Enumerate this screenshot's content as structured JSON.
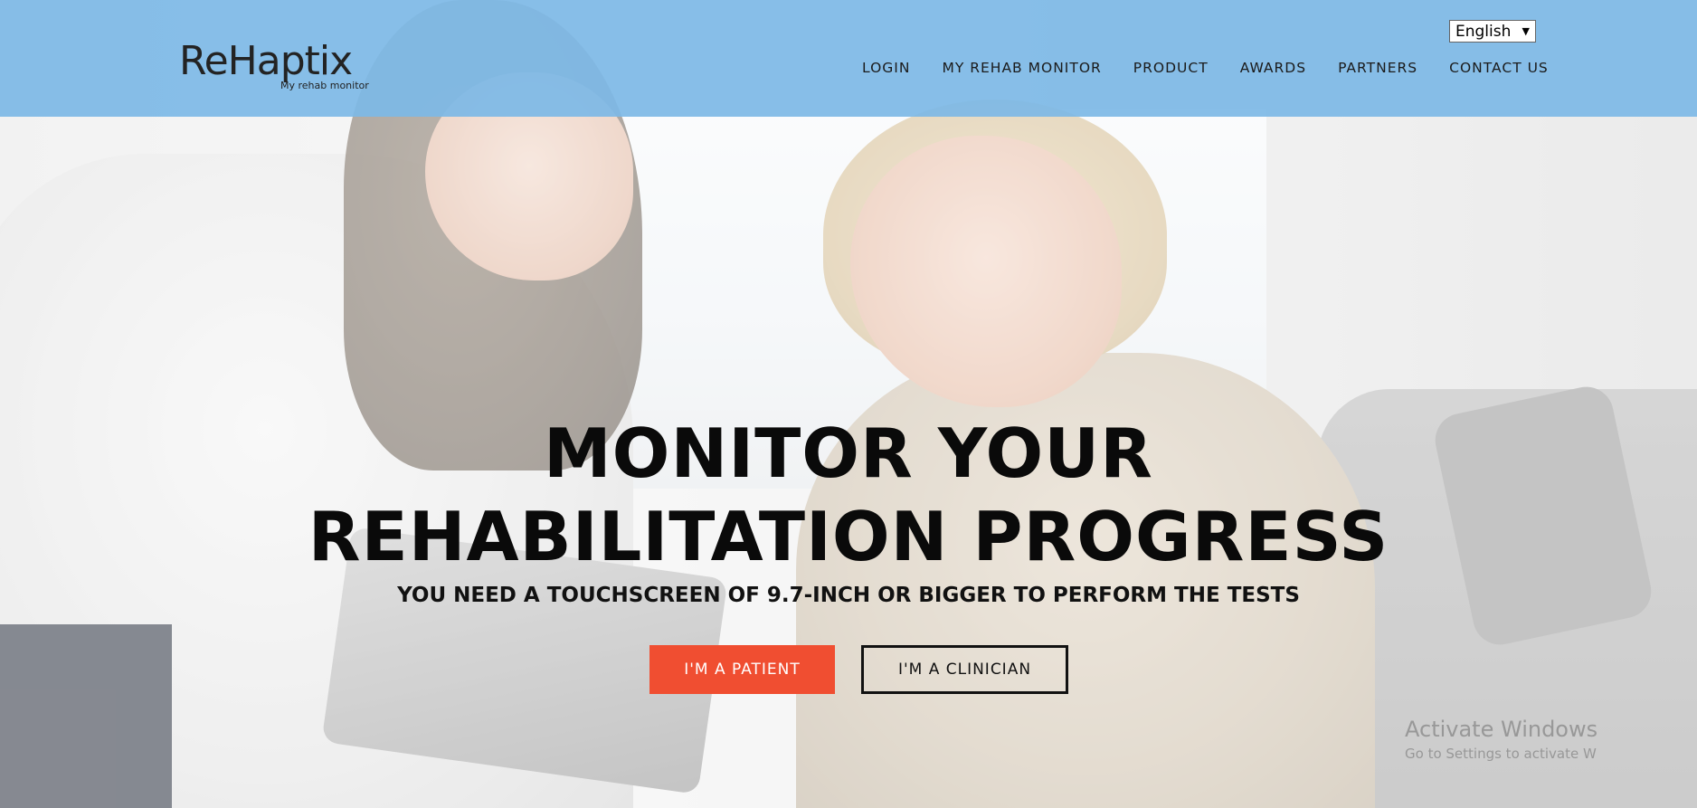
{
  "header": {
    "logo_text": "ReHaptix",
    "logo_subtitle": "My rehab monitor",
    "language": "English",
    "nav": [
      {
        "label": "LOGIN"
      },
      {
        "label": "MY REHAB MONITOR"
      },
      {
        "label": "PRODUCT"
      },
      {
        "label": "AWARDS"
      },
      {
        "label": "PARTNERS"
      },
      {
        "label": "CONTACT US"
      }
    ]
  },
  "hero": {
    "title_line1": "MONITOR YOUR",
    "title_line2": "REHABILITATION PROGRESS",
    "subtitle": "YOU NEED A TOUCHSCREEN OF 9.7-INCH OR BIGGER TO PERFORM THE TESTS",
    "patient_button": "I'M A PATIENT",
    "clinician_button": "I'M A CLINICIAN"
  },
  "watermark": {
    "title": "Activate Windows",
    "subtitle": "Go to Settings to activate W"
  },
  "colors": {
    "header_bg": "#7db9e6",
    "patient_button_bg": "#f04e31"
  }
}
